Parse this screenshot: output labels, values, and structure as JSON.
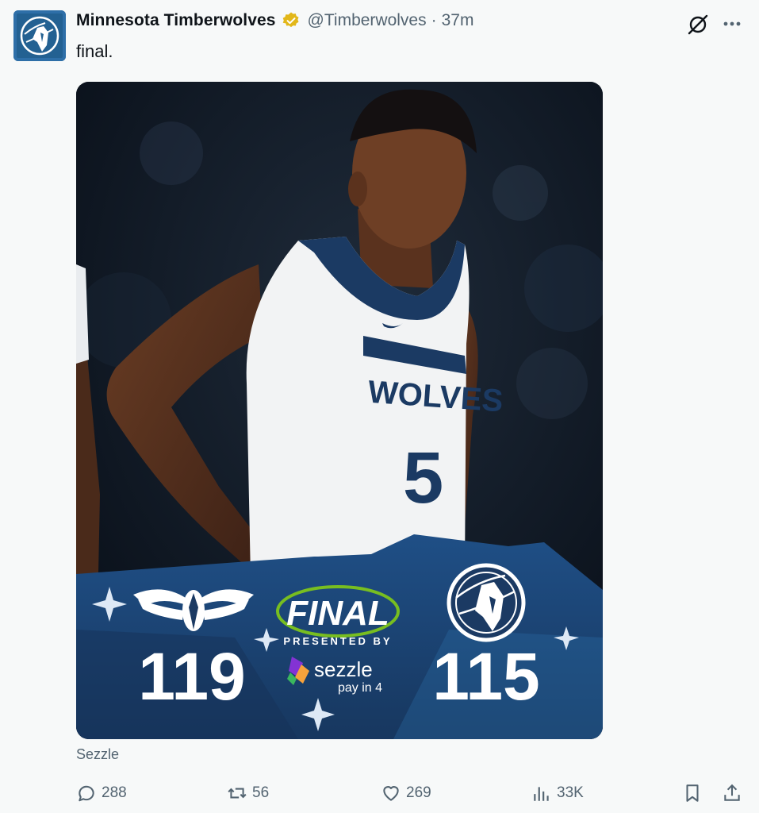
{
  "post": {
    "author_name": "Minnesota Timberwolves",
    "handle": "@Timberwolves",
    "separator": "·",
    "time": "37m",
    "text": "final.",
    "source_label": "Sezzle"
  },
  "media": {
    "jersey_team": "WOLVES",
    "jersey_number": "5",
    "final_label": "FINAL",
    "presented_by": "PRESENTED BY",
    "sponsor_name": "sezzle",
    "sponsor_tagline": "pay in 4",
    "away_score": "119",
    "home_score": "115",
    "colors": {
      "navy": "#1b3a63",
      "light_blue": "#2c6ea5",
      "accent_green": "#78be20"
    }
  },
  "actions": {
    "replies": "288",
    "reposts": "56",
    "likes": "269",
    "views": "33K"
  },
  "icons": [
    "verified-badge-icon",
    "grok-icon",
    "more-icon",
    "reply-icon",
    "repost-icon",
    "like-icon",
    "views-icon",
    "bookmark-icon",
    "share-icon"
  ]
}
